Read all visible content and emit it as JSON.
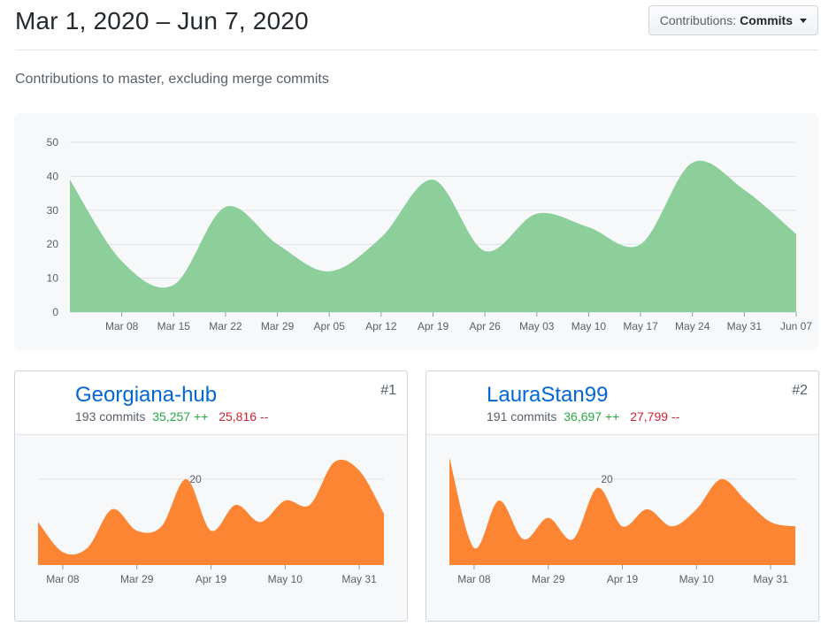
{
  "header": {
    "date_range": "Mar 1, 2020 – Jun 7, 2020",
    "contrib_prefix": "Contributions:",
    "contrib_value": "Commits"
  },
  "subtitle": "Contributions to master, excluding merge commits",
  "colors": {
    "main_area": "#8ccf9b",
    "user_area": "#fb8532",
    "grid": "#dfe2e5",
    "axis_text": "#586069"
  },
  "chart_data": [
    {
      "type": "area",
      "y_ticks": [
        0,
        10,
        20,
        30,
        40,
        50
      ],
      "ylim": [
        0,
        50
      ],
      "x_labels": [
        "Mar 08",
        "Mar 15",
        "Mar 22",
        "Mar 29",
        "Apr 05",
        "Apr 12",
        "Apr 19",
        "Apr 26",
        "May 03",
        "May 10",
        "May 17",
        "May 24",
        "May 31",
        "Jun 07"
      ],
      "x": [
        "Mar 01",
        "Mar 08",
        "Mar 15",
        "Mar 22",
        "Mar 29",
        "Apr 05",
        "Apr 12",
        "Apr 19",
        "Apr 26",
        "May 03",
        "May 10",
        "May 17",
        "May 24",
        "May 31",
        "Jun 07"
      ],
      "values": [
        39,
        15,
        8,
        31,
        20,
        12,
        22,
        39,
        18,
        29,
        25,
        20,
        44,
        36,
        23
      ]
    },
    {
      "type": "area",
      "y_ticks": [
        20
      ],
      "ylim": [
        0,
        28
      ],
      "x_labels": [
        "Mar 08",
        "Mar 29",
        "Apr 19",
        "May 10",
        "May 31"
      ],
      "x": [
        "Mar 01",
        "Mar 08",
        "Mar 15",
        "Mar 22",
        "Mar 29",
        "Apr 05",
        "Apr 12",
        "Apr 19",
        "Apr 26",
        "May 03",
        "May 10",
        "May 17",
        "May 24",
        "May 31",
        "Jun 07"
      ],
      "values": [
        10,
        3,
        4,
        13,
        8,
        9,
        20,
        8,
        14,
        10,
        15,
        14,
        24,
        22,
        12
      ]
    },
    {
      "type": "area",
      "y_ticks": [
        20
      ],
      "ylim": [
        0,
        28
      ],
      "x_labels": [
        "Mar 08",
        "Mar 29",
        "Apr 19",
        "May 10",
        "May 31"
      ],
      "x": [
        "Mar 01",
        "Mar 08",
        "Mar 15",
        "Mar 22",
        "Mar 29",
        "Apr 05",
        "Apr 12",
        "Apr 19",
        "Apr 26",
        "May 03",
        "May 10",
        "May 17",
        "May 24",
        "May 31",
        "Jun 07"
      ],
      "values": [
        25,
        4,
        15,
        6,
        11,
        6,
        18,
        9,
        13,
        9,
        13,
        20,
        15,
        10,
        9
      ]
    }
  ],
  "contributors": [
    {
      "name": "Georgiana-hub",
      "commits": "193 commits",
      "additions": "35,257 ++",
      "deletions": "25,816 --",
      "rank": "#1",
      "avatar": "photo-avatar-icon"
    },
    {
      "name": "LauraStan99",
      "commits": "191 commits",
      "additions": "36,697 ++",
      "deletions": "27,799 --",
      "rank": "#2",
      "avatar": "identicon-avatar-icon"
    }
  ]
}
